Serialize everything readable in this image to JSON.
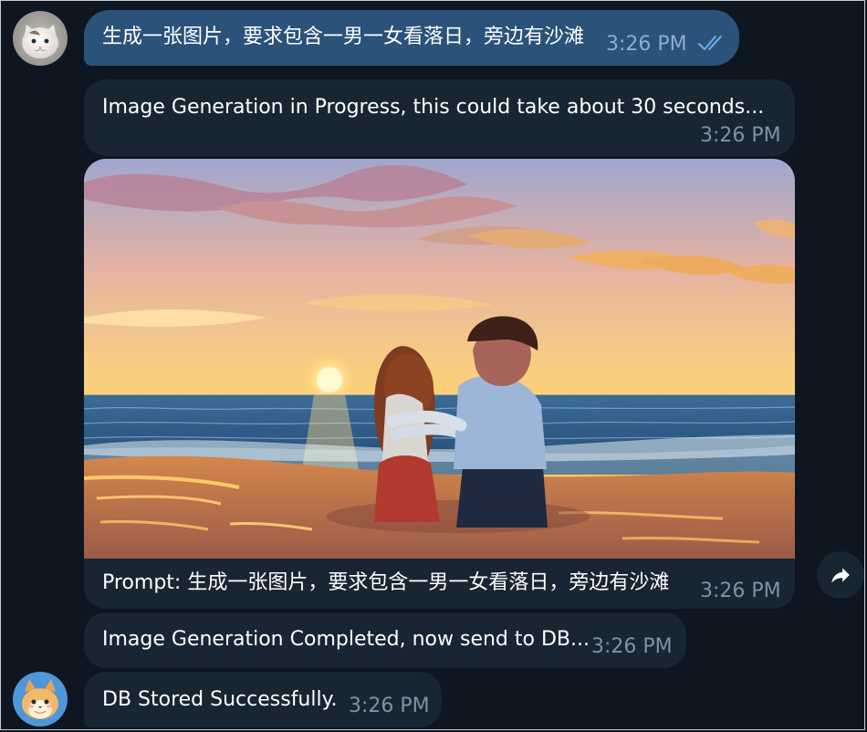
{
  "messages": [
    {
      "direction": "outgoing",
      "text": "生成一张图片，要求包含一男一女看落日，旁边有沙滩",
      "time": "3:26 PM",
      "status_icon": "double-check-icon"
    },
    {
      "direction": "incoming",
      "text": "Image Generation in Progress, this could take about 30 seconds...",
      "time": "3:26 PM"
    },
    {
      "direction": "incoming",
      "image": "generated-sunset-beach-image",
      "caption": "Prompt: 生成一张图片，要求包含一男一女看落日，旁边有沙滩",
      "time": "3:26 PM"
    },
    {
      "direction": "incoming",
      "text": "Image Generation Completed, now send to DB...",
      "time": "3:26 PM"
    },
    {
      "direction": "incoming",
      "text": "DB Stored Successfully.",
      "time": "3:26 PM"
    }
  ],
  "avatars": {
    "user": "cat-avatar",
    "bot": "shiba-dog-avatar"
  },
  "actions": {
    "forward_icon": "forward-arrow-icon"
  },
  "colors": {
    "background": "#0e1621",
    "outgoing_bubble": "#2b5278",
    "incoming_bubble": "#182533",
    "incoming_time": "#7f91a4",
    "outgoing_time": "#8aaed0",
    "read_ticks": "#63a8e6"
  }
}
